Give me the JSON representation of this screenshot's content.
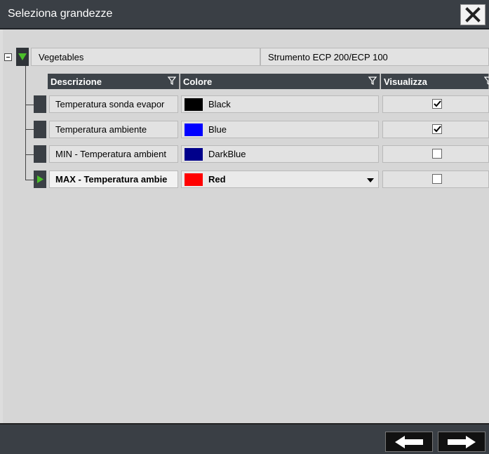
{
  "window": {
    "title": "Seleziona grandezze"
  },
  "group": {
    "name": "Vegetables",
    "instrument": "Strumento ECP 200/ECP 100"
  },
  "columns": {
    "description": "Descrizione",
    "color": "Colore",
    "show": "Visualizza"
  },
  "rows": [
    {
      "description": "Temperatura sonda evapor",
      "color_name": "Black",
      "color_hex": "#000000",
      "checked": true
    },
    {
      "description": "Temperatura ambiente",
      "color_name": "Blue",
      "color_hex": "#0000ff",
      "checked": true
    },
    {
      "description": "MIN - Temperatura ambient",
      "color_name": "DarkBlue",
      "color_hex": "#00008b",
      "checked": false
    },
    {
      "description": "MAX - Temperatura ambie",
      "color_name": "Red",
      "color_hex": "#ff0000",
      "checked": false
    }
  ]
}
